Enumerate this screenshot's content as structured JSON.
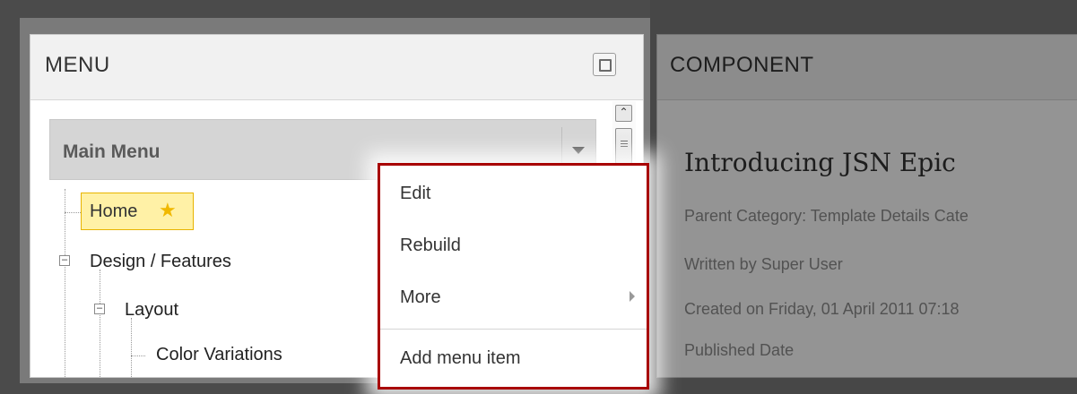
{
  "menu_panel": {
    "title": "MENU",
    "selected_menu": "Main Menu",
    "tree": [
      {
        "label": "Home",
        "starred": true
      },
      {
        "label": "Design / Features"
      },
      {
        "label": "Layout"
      },
      {
        "label": "Color Variations"
      }
    ]
  },
  "context_menu": {
    "items": [
      "Edit",
      "Rebuild",
      "More",
      "Add menu item"
    ]
  },
  "component_panel": {
    "title": "COMPONENT",
    "article_title": "Introducing JSN Epic",
    "meta": {
      "category": "Parent Category: Template Details  Cate",
      "author": "Written by Super User",
      "created": "Created on Friday, 01 April 2011 07:18",
      "published": "Published Date"
    }
  },
  "colors": {
    "highlight_border": "#a80000",
    "home_bg": "#fff1a6",
    "star": "#f0b800"
  }
}
